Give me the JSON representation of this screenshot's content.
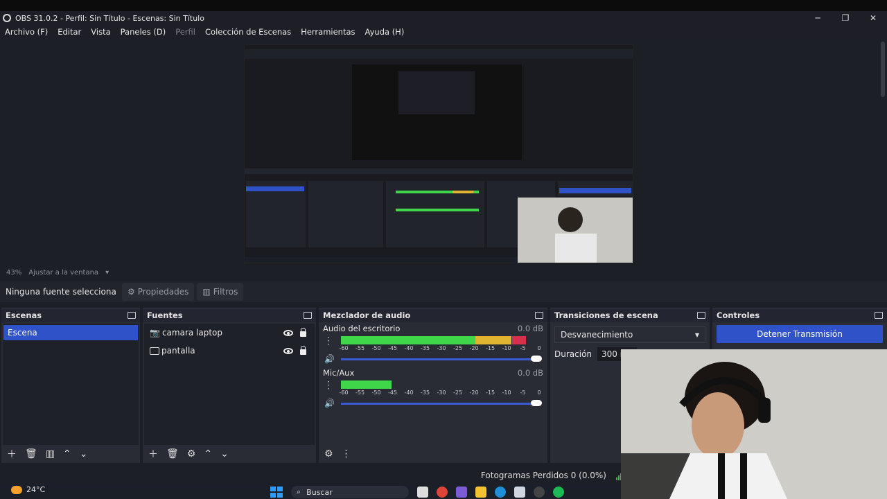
{
  "window": {
    "title": "OBS 31.0.2 - Perfil: Sin Título - Escenas: Sin Título",
    "controls": [
      "─",
      "❐",
      "✕"
    ]
  },
  "menu": [
    "Archivo (F)",
    "Editar",
    "Vista",
    "Paneles (D)",
    "Perfil",
    "Colección de Escenas",
    "Herramientas",
    "Ayuda (H)"
  ],
  "zoom": {
    "percent": "43%",
    "label": "Ajustar a la ventana"
  },
  "source_bar": {
    "none_selected": "Ninguna fuente selecciona",
    "properties": "Propiedades",
    "filters": "Filtros"
  },
  "scenes": {
    "title": "Escenas",
    "items": [
      "Escena"
    ]
  },
  "sources": {
    "title": "Fuentes",
    "items": [
      {
        "name": "camara laptop",
        "icon": "camera-icon"
      },
      {
        "name": "pantalla",
        "icon": "monitor-icon"
      }
    ]
  },
  "mixer": {
    "title": "Mezclador de audio",
    "channels": [
      {
        "name": "Audio del escritorio",
        "db": "0.0 dB",
        "level": 0.92
      },
      {
        "name": "Mic/Aux",
        "db": "0.0 dB",
        "level": 0.25
      }
    ],
    "scale": [
      "-60",
      "-55",
      "-50",
      "-45",
      "-40",
      "-35",
      "-30",
      "-25",
      "-20",
      "-15",
      "-10",
      "-5",
      "0"
    ]
  },
  "transitions": {
    "title": "Transiciones de escena",
    "selected": "Desvanecimiento",
    "duration_label": "Duración",
    "duration_value": "300 ms"
  },
  "controls": {
    "title": "Controles",
    "stop_stream": "Detener Transmisión"
  },
  "status": {
    "dropped_frames": "Fotogramas Perdidos 0 (0.0%)"
  },
  "taskbar": {
    "temperature": "24°C",
    "search": "Buscar"
  },
  "colors": {
    "accent": "#2f52c9",
    "meter_green": "#3fd64a",
    "meter_yellow": "#e0b431",
    "meter_red": "#d6304a"
  }
}
